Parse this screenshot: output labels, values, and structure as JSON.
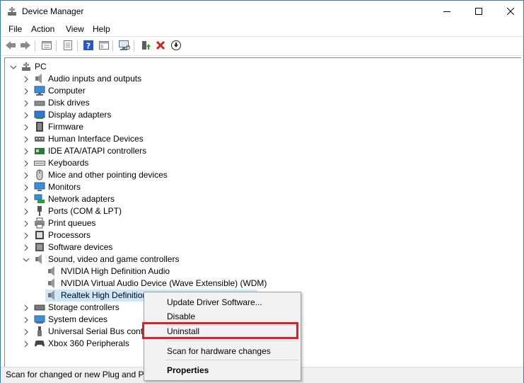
{
  "window": {
    "title": "Device Manager",
    "icon": "device-manager-icon",
    "controls": [
      "minimize-icon",
      "maximize-icon",
      "close-icon"
    ]
  },
  "menu": [
    "File",
    "Action",
    "View",
    "Help"
  ],
  "toolbar": {
    "buttons": [
      "back-arrow-icon",
      "forward-arrow-icon",
      "properties-sheet-icon",
      "show-hidden-icon",
      "help-icon",
      "console-tree-icon",
      "scan-hardware-icon",
      "update-driver-icon",
      "uninstall-x-icon",
      "download-icon"
    ]
  },
  "tree": {
    "root": "PC",
    "categories": [
      {
        "label": "Audio inputs and outputs",
        "icon": "speaker-icon"
      },
      {
        "label": "Computer",
        "icon": "computer-icon"
      },
      {
        "label": "Disk drives",
        "icon": "disk-drive-icon"
      },
      {
        "label": "Display adapters",
        "icon": "display-adapter-icon"
      },
      {
        "label": "Firmware",
        "icon": "firmware-chip-icon"
      },
      {
        "label": "Human Interface Devices",
        "icon": "hid-icon"
      },
      {
        "label": "IDE ATA/ATAPI controllers",
        "icon": "ide-controller-icon"
      },
      {
        "label": "Keyboards",
        "icon": "keyboard-icon"
      },
      {
        "label": "Mice and other pointing devices",
        "icon": "mouse-icon"
      },
      {
        "label": "Monitors",
        "icon": "monitor-icon"
      },
      {
        "label": "Network adapters",
        "icon": "network-adapter-icon"
      },
      {
        "label": "Ports (COM & LPT)",
        "icon": "port-icon"
      },
      {
        "label": "Print queues",
        "icon": "printer-icon"
      },
      {
        "label": "Processors",
        "icon": "processor-icon"
      },
      {
        "label": "Software devices",
        "icon": "software-device-icon"
      },
      {
        "label": "Sound, video and game controllers",
        "icon": "speaker-icon",
        "expanded": true,
        "children": [
          {
            "label": "NVIDIA High Definition Audio",
            "icon": "speaker-icon"
          },
          {
            "label": "NVIDIA Virtual Audio Device (Wave Extensible) (WDM)",
            "icon": "speaker-icon"
          },
          {
            "label": "Realtek High Definition Audio",
            "icon": "speaker-icon",
            "selected": true
          }
        ]
      },
      {
        "label": "Storage controllers",
        "icon": "storage-controller-icon"
      },
      {
        "label": "System devices",
        "icon": "system-device-icon"
      },
      {
        "label": "Universal Serial Bus controllers",
        "icon": "usb-icon"
      },
      {
        "label": "Xbox 360 Peripherals",
        "icon": "gamepad-icon"
      }
    ]
  },
  "context_menu": {
    "items": [
      "Update Driver Software...",
      "Disable",
      "Uninstall",
      "Scan for hardware changes",
      "Properties"
    ],
    "highlighted": "Uninstall"
  },
  "status": "Scan for changed or new Plug and Play hardware.",
  "colors": {
    "selection": "#cce8ff",
    "highlight_border": "#e11d2a",
    "window_border": "#3c79b8"
  }
}
